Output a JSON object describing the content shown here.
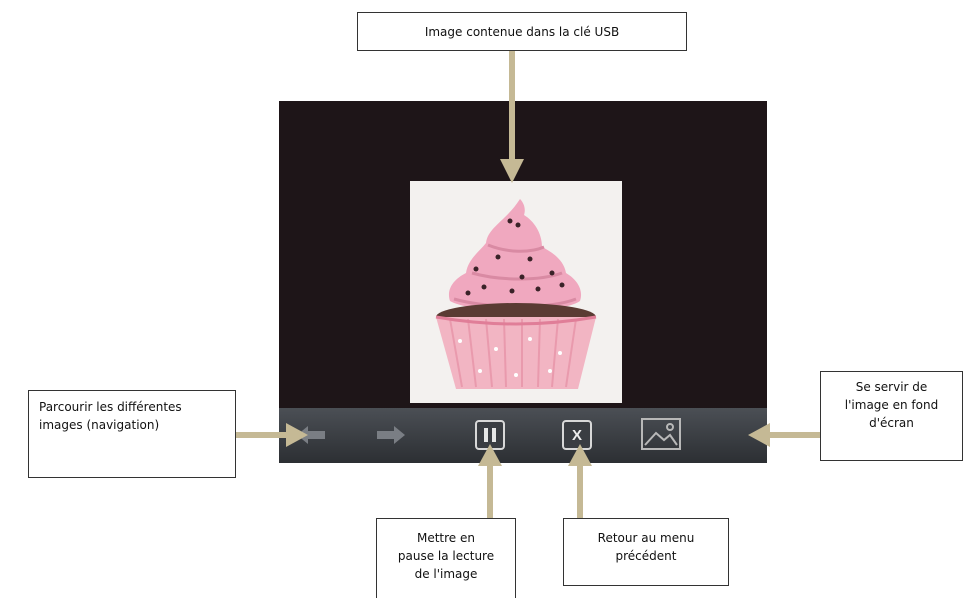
{
  "callouts": {
    "image_source": "Image contenue dans la clé USB",
    "navigation_line1": "Parcourir les différentes",
    "navigation_line2": "images (navigation)",
    "wallpaper_line1": "Se servir de",
    "wallpaper_line2": "l'image en fond",
    "wallpaper_line3": "d'écran",
    "pause_line1": "Mettre en",
    "pause_line2": "pause la lecture",
    "pause_line3": "de l'image",
    "back_line1": "Retour au menu",
    "back_line2": "précédent"
  },
  "toolbar": {
    "close_glyph": "X"
  },
  "colors": {
    "arrow": "#c5b995",
    "screen_bg": "#1e1518",
    "toolbar_bg": "#3b3f44",
    "frosting": "#f0a8bf",
    "cake": "#5a3b33",
    "wrapper": "#f2b5c3"
  },
  "icons": [
    "prev-arrow-icon",
    "next-arrow-icon",
    "pause-icon",
    "close-icon",
    "wallpaper-icon",
    "cupcake-photo"
  ]
}
